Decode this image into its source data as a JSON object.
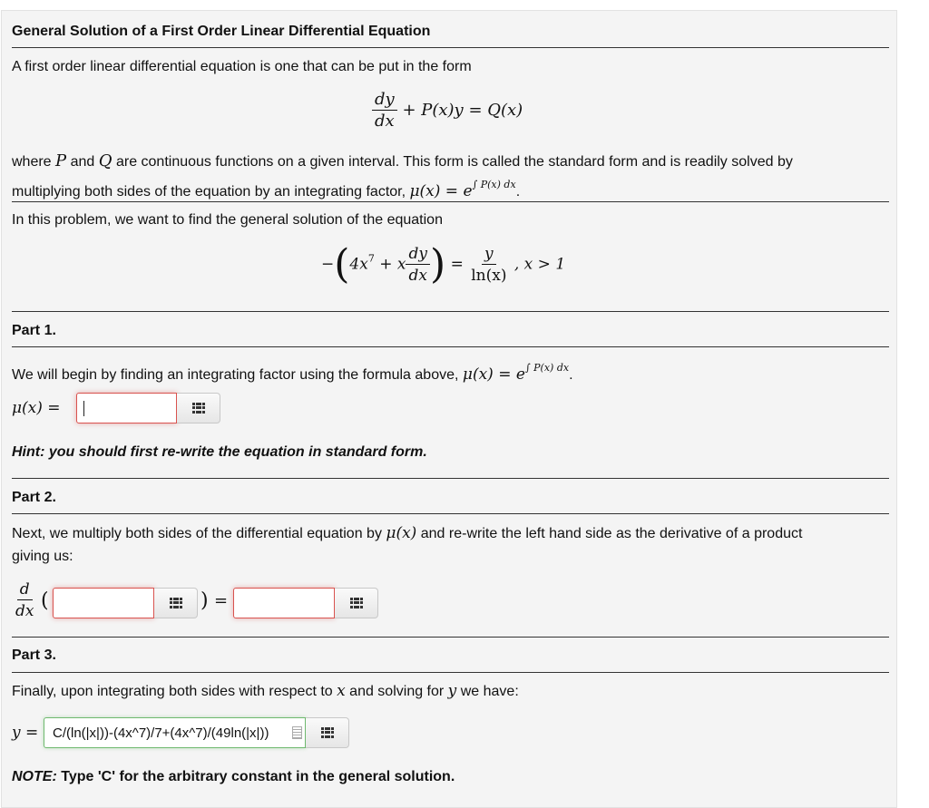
{
  "header": {
    "title": "General Solution of a First Order Linear Differential Equation"
  },
  "intro": {
    "line1": "A first order linear differential equation is one that can be put in the form",
    "standard_form": {
      "num": "dy",
      "den": "dx",
      "rest": "+ P(x)y = Q(x)"
    },
    "para2_a": "where ",
    "para2_P": "P",
    "para2_b": " and ",
    "para2_Q": "Q",
    "para2_c": " are continuous functions on a given interval. This form is called the standard form and is readily solved by",
    "para2_line2": "multiplying both sides of the equation by an integrating factor, ",
    "integrating_factor": "μ(x) = e",
    "integrating_factor_exp": "∫ P(x) dx",
    "period": "."
  },
  "problem": {
    "text": "In this problem, we want to find the general solution of the equation",
    "equation": {
      "minus": "−",
      "lhs_a": "4x",
      "lhs_exp": "7",
      "lhs_b": "+ x",
      "d_num": "dy",
      "d_den": "dx",
      "eq": "=",
      "rhs_num": "y",
      "rhs_den": "ln(x)",
      "condition": ", x > 1"
    }
  },
  "part1": {
    "heading": "Part 1.",
    "text": "We will begin by finding an integrating factor using the formula above, ",
    "formula": "μ(x) = e",
    "formula_exp": "∫ P(x) dx",
    "period": ".",
    "label": "μ(x) =",
    "input_value": "",
    "hint": "Hint: you should first re-write the equation in standard form."
  },
  "part2": {
    "heading": "Part 2.",
    "text_a": "Next, we multiply both sides of the differential equation by ",
    "mu": "μ(x)",
    "text_b": " and re-write the left hand side as the derivative of a product",
    "text_c": "giving us:",
    "d_num": "d",
    "d_den": "dx",
    "open_paren": "(",
    "close_paren": ")",
    "equals": "=",
    "input1_value": "",
    "input2_value": ""
  },
  "part3": {
    "heading": "Part 3.",
    "text_a": "Finally, upon integrating both sides with respect to ",
    "x": "x",
    "text_b": " and solving for ",
    "y": "y",
    "text_c": " we have:",
    "label": "y =",
    "answer_value": "C/(ln(|x|))-(4x^7)/7+(4x^7)/(49ln(|x|))",
    "note_bold": "NOTE:",
    "note_rest": " Type 'C' for the arbitrary constant in the general solution."
  },
  "colors": {
    "invalid_border": "#d9534f",
    "valid_border": "#6fb96f",
    "panel_bg": "#f4f4f4"
  }
}
